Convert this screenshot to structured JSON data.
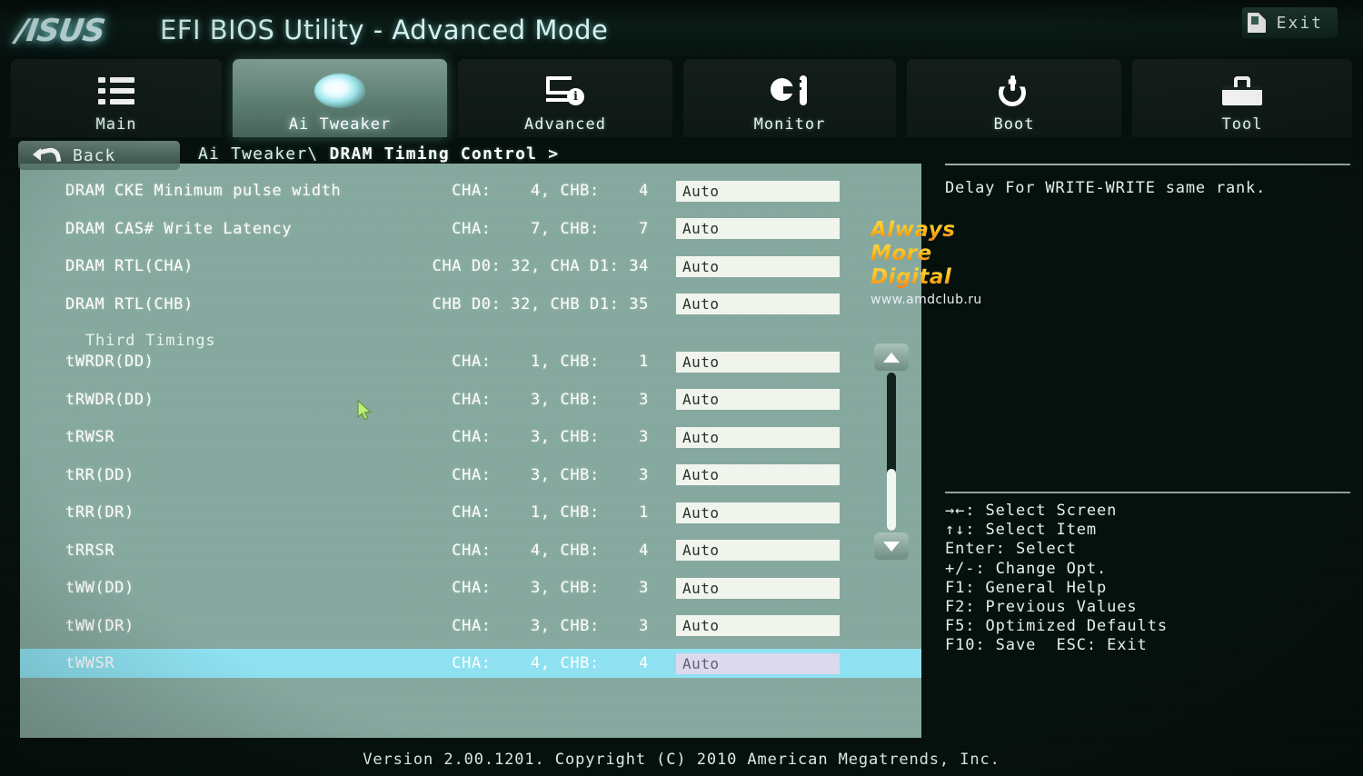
{
  "header": {
    "brand": "/ISUS",
    "title": "EFI BIOS Utility - Advanced Mode",
    "exit_label": "Exit",
    "exit_icon": "exit-door-icon"
  },
  "tabs": [
    {
      "label": "Main",
      "icon": "list-icon",
      "active": false
    },
    {
      "label": "Ai Tweaker",
      "icon": "ai-glow-icon",
      "active": true
    },
    {
      "label": "Advanced",
      "icon": "monitor-info-icon",
      "active": false
    },
    {
      "label": "Monitor",
      "icon": "fan-thermometer-icon",
      "active": false
    },
    {
      "label": "Boot",
      "icon": "power-icon",
      "active": false
    },
    {
      "label": "Tool",
      "icon": "toolbox-icon",
      "active": false
    }
  ],
  "nav": {
    "back_label": "Back",
    "back_icon": "back-arrow-icon",
    "breadcrumb_prefix": "Ai Tweaker\\ ",
    "breadcrumb_current": "DRAM Timing Control >"
  },
  "settings": {
    "rows": [
      {
        "kind": "item",
        "label": "DRAM CKE Minimum pulse width",
        "value": "CHA:    4, CHB:    4",
        "field": "Auto",
        "selected": false
      },
      {
        "kind": "item",
        "label": "DRAM CAS# Write Latency",
        "value": "CHA:    7, CHB:    7",
        "field": "Auto",
        "selected": false
      },
      {
        "kind": "item",
        "label": "DRAM RTL(CHA)",
        "value": "CHA D0: 32, CHA D1: 34",
        "field": "Auto",
        "selected": false
      },
      {
        "kind": "item",
        "label": "DRAM RTL(CHB)",
        "value": "CHB D0: 32, CHB D1: 35",
        "field": "Auto",
        "selected": false
      },
      {
        "kind": "section",
        "label": "Third Timings",
        "value": "",
        "field": "",
        "selected": false
      },
      {
        "kind": "item",
        "label": "tWRDR(DD)",
        "value": "CHA:    1, CHB:    1",
        "field": "Auto",
        "selected": false
      },
      {
        "kind": "item",
        "label": "tRWDR(DD)",
        "value": "CHA:    3, CHB:    3",
        "field": "Auto",
        "selected": false
      },
      {
        "kind": "item",
        "label": "tRWSR",
        "value": "CHA:    3, CHB:    3",
        "field": "Auto",
        "selected": false
      },
      {
        "kind": "item",
        "label": "tRR(DD)",
        "value": "CHA:    3, CHB:    3",
        "field": "Auto",
        "selected": false
      },
      {
        "kind": "item",
        "label": "tRR(DR)",
        "value": "CHA:    1, CHB:    1",
        "field": "Auto",
        "selected": false
      },
      {
        "kind": "item",
        "label": "tRRSR",
        "value": "CHA:    4, CHB:    4",
        "field": "Auto",
        "selected": false
      },
      {
        "kind": "item",
        "label": "tWW(DD)",
        "value": "CHA:    3, CHB:    3",
        "field": "Auto",
        "selected": false
      },
      {
        "kind": "item",
        "label": "tWW(DR)",
        "value": "CHA:    3, CHB:    3",
        "field": "Auto",
        "selected": false
      },
      {
        "kind": "item",
        "label": "tWWSR",
        "value": "CHA:    4, CHB:    4",
        "field": "Auto",
        "selected": true
      }
    ]
  },
  "scrollbar": {
    "up_icon": "scroll-up-arrow-icon",
    "down_icon": "scroll-down-arrow-icon"
  },
  "help": {
    "text": "Delay For WRITE-WRITE same rank."
  },
  "watermark": {
    "line1": "Always",
    "line2": "More",
    "line3": "Digital",
    "url": "www.amdclub.ru"
  },
  "legend": {
    "lines": [
      "→←: Select Screen",
      "↑↓: Select Item",
      "Enter: Select",
      "+/-: Change Opt.",
      "F1: General Help",
      "F2: Previous Values",
      "F5: Optimized Defaults",
      "F10: Save  ESC: Exit"
    ]
  },
  "footer": {
    "text": "Version 2.00.1201. Copyright (C) 2010 American Megatrends, Inc."
  },
  "colors": {
    "panel_bg": "#86a99f",
    "selection": "#8fe2f2",
    "field_bg": "#f2f5ee",
    "chrome_bg": "#0a1a14",
    "accent_text": "#e3f2ea",
    "watermark_gold": "#ffc21e"
  }
}
